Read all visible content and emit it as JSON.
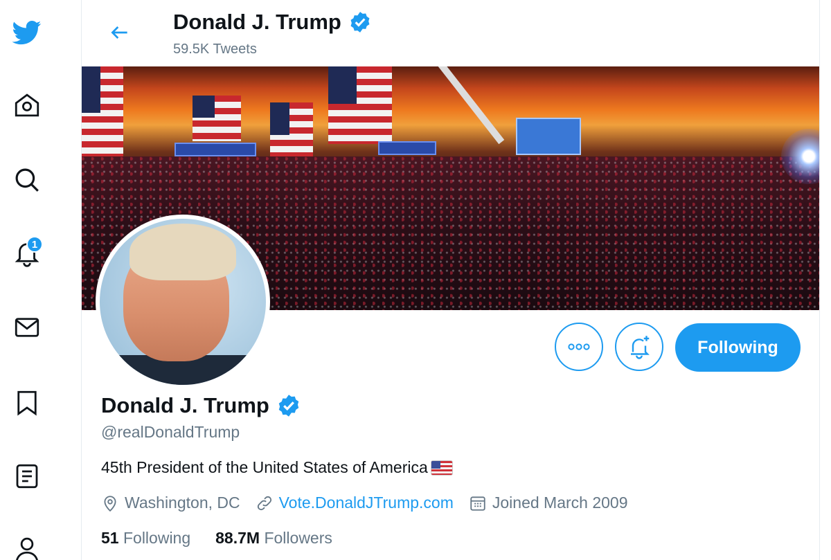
{
  "colors": {
    "accent": "#1d9bf0",
    "text": "#0f1419",
    "secondary": "#657786"
  },
  "nav": {
    "items": [
      {
        "icon": "twitter-bird-icon"
      },
      {
        "icon": "home-icon"
      },
      {
        "icon": "search-icon"
      },
      {
        "icon": "bell-icon",
        "badge": "1"
      },
      {
        "icon": "mail-icon"
      },
      {
        "icon": "bookmark-icon"
      },
      {
        "icon": "list-icon"
      },
      {
        "icon": "profile-icon"
      }
    ]
  },
  "header": {
    "title": "Donald J. Trump",
    "subtitle": "59.5K Tweets"
  },
  "actions": {
    "more_icon": "more-icon",
    "notify_icon": "bell-plus-icon",
    "follow_label": "Following"
  },
  "profile": {
    "name": "Donald J. Trump",
    "handle": "@realDonaldTrump",
    "bio": "45th President of the United States of America",
    "location": "Washington, DC",
    "website": "Vote.DonaldJTrump.com",
    "joined": "Joined March 2009",
    "following_count": "51",
    "following_label": "Following",
    "followers_count": "88.7M",
    "followers_label": "Followers"
  }
}
